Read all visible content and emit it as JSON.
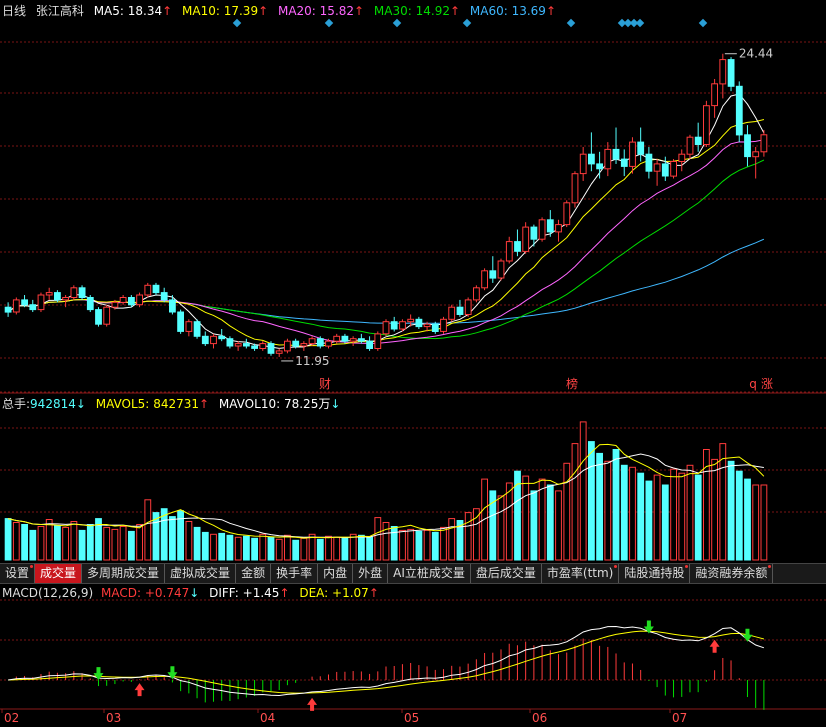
{
  "main_legend": {
    "period": "日线",
    "stock_name": "张江高科",
    "ma5_label": "MA5:",
    "ma5_value": "18.34",
    "ma10_label": "MA10:",
    "ma10_value": "17.39",
    "ma20_label": "MA20:",
    "ma20_value": "15.82",
    "ma30_label": "MA30:",
    "ma30_value": "14.92",
    "ma60_label": "MA60:",
    "ma60_value": "13.69",
    "up_arrow": "↑"
  },
  "volume_legend": {
    "total_label": "总手:",
    "total_value": "942814",
    "total_arrow": "↓",
    "mavol5_label": "MAVOL5:",
    "mavol5_value": "842731",
    "mavol5_arrow": "↑",
    "mavol10_label": "MAVOL10:",
    "mavol10_value": "78.25万",
    "mavol10_arrow": "↓"
  },
  "macd_legend": {
    "name": "MACD(12,26,9)",
    "macd_label": "MACD:",
    "macd_value": "+0.747",
    "macd_arrow": "↓",
    "diff_label": "DIFF:",
    "diff_value": "+1.45",
    "diff_arrow": "↑",
    "dea_label": "DEA:",
    "dea_value": "+1.07",
    "dea_arrow": "↑"
  },
  "tabs": [
    {
      "label": "设置",
      "dot": true
    },
    {
      "label": "成交量",
      "active": true
    },
    {
      "label": "多周期成交量"
    },
    {
      "label": "虚拟成交量"
    },
    {
      "label": "金额"
    },
    {
      "label": "换手率"
    },
    {
      "label": "内盘"
    },
    {
      "label": "外盘"
    },
    {
      "label": "AI立桩成交量"
    },
    {
      "label": "盘后成交量"
    },
    {
      "label": "市盈率(ttm)",
      "dot": true
    },
    {
      "label": "陆股通持股",
      "dot": true
    },
    {
      "label": "融资融券余额",
      "dot": true
    }
  ],
  "markers": {
    "low_price": "11.95",
    "high_price": "24.44",
    "event_cai": "财",
    "event_bang": "榜",
    "event_q": "q",
    "event_zhang": "涨"
  },
  "x_axis_labels": [
    "02",
    "03",
    "04",
    "05",
    "06",
    "07"
  ],
  "colors": {
    "up": "#ff3b3b",
    "down": "#54ffff",
    "ma5": "#ffffff",
    "ma10": "#ffff00",
    "ma20": "#ff66ff",
    "ma30": "#00dd00",
    "ma60": "#3fb8ff",
    "grid": "#7a1414",
    "diamond": "#2a9fd6"
  },
  "chart_data": {
    "type": "candlestick",
    "title": "张江高科 日线",
    "price_range": [
      11.0,
      25.5
    ],
    "ohlc": [
      [
        14.0,
        14.2,
        13.6,
        13.8
      ],
      [
        13.8,
        14.4,
        13.7,
        14.3
      ],
      [
        14.3,
        14.5,
        14.0,
        14.1
      ],
      [
        14.1,
        14.3,
        13.8,
        13.9
      ],
      [
        13.9,
        14.6,
        13.8,
        14.5
      ],
      [
        14.5,
        14.8,
        14.3,
        14.6
      ],
      [
        14.6,
        14.7,
        14.2,
        14.3
      ],
      [
        14.3,
        14.5,
        14.0,
        14.4
      ],
      [
        14.4,
        14.9,
        14.3,
        14.8
      ],
      [
        14.8,
        14.9,
        14.3,
        14.4
      ],
      [
        14.4,
        14.5,
        13.8,
        13.9
      ],
      [
        13.9,
        14.0,
        13.2,
        13.3
      ],
      [
        13.3,
        14.1,
        13.2,
        14.0
      ],
      [
        14.0,
        14.3,
        13.9,
        14.2
      ],
      [
        14.2,
        14.5,
        14.1,
        14.4
      ],
      [
        14.4,
        14.5,
        14.0,
        14.1
      ],
      [
        14.1,
        14.6,
        14.0,
        14.5
      ],
      [
        14.5,
        15.0,
        14.4,
        14.9
      ],
      [
        14.9,
        15.0,
        14.5,
        14.6
      ],
      [
        14.6,
        14.8,
        14.2,
        14.3
      ],
      [
        14.3,
        14.5,
        13.7,
        13.8
      ],
      [
        13.8,
        13.9,
        12.9,
        13.0
      ],
      [
        13.0,
        13.5,
        12.8,
        13.4
      ],
      [
        13.4,
        13.5,
        12.7,
        12.8
      ],
      [
        12.8,
        13.0,
        12.4,
        12.5
      ],
      [
        12.5,
        12.9,
        12.3,
        12.8
      ],
      [
        12.8,
        13.1,
        12.6,
        12.7
      ],
      [
        12.7,
        12.8,
        12.3,
        12.4
      ],
      [
        12.4,
        12.6,
        12.2,
        12.5
      ],
      [
        12.5,
        12.7,
        12.3,
        12.4
      ],
      [
        12.4,
        12.5,
        12.2,
        12.3
      ],
      [
        12.3,
        12.6,
        12.2,
        12.5
      ],
      [
        12.5,
        12.6,
        12.0,
        12.1
      ],
      [
        12.1,
        12.3,
        11.95,
        12.2
      ],
      [
        12.2,
        12.7,
        12.1,
        12.6
      ],
      [
        12.6,
        12.7,
        12.3,
        12.4
      ],
      [
        12.4,
        12.6,
        12.2,
        12.5
      ],
      [
        12.5,
        12.8,
        12.4,
        12.7
      ],
      [
        12.7,
        12.8,
        12.3,
        12.4
      ],
      [
        12.4,
        12.7,
        12.3,
        12.6
      ],
      [
        12.6,
        12.9,
        12.5,
        12.8
      ],
      [
        12.8,
        12.9,
        12.5,
        12.6
      ],
      [
        12.6,
        12.8,
        12.4,
        12.7
      ],
      [
        12.7,
        12.9,
        12.5,
        12.6
      ],
      [
        12.6,
        12.8,
        12.2,
        12.3
      ],
      [
        12.3,
        13.0,
        12.2,
        12.9
      ],
      [
        12.9,
        13.5,
        12.8,
        13.4
      ],
      [
        13.4,
        13.6,
        13.0,
        13.1
      ],
      [
        13.1,
        13.5,
        13.0,
        13.4
      ],
      [
        13.4,
        13.7,
        13.2,
        13.5
      ],
      [
        13.5,
        13.6,
        13.1,
        13.2
      ],
      [
        13.2,
        13.4,
        13.0,
        13.3
      ],
      [
        13.3,
        13.4,
        12.9,
        13.0
      ],
      [
        13.0,
        13.6,
        12.9,
        13.5
      ],
      [
        13.5,
        14.1,
        13.4,
        14.0
      ],
      [
        14.0,
        14.3,
        13.6,
        13.7
      ],
      [
        13.7,
        14.4,
        13.6,
        14.3
      ],
      [
        14.3,
        14.9,
        14.2,
        14.8
      ],
      [
        14.8,
        15.6,
        14.7,
        15.5
      ],
      [
        15.5,
        16.1,
        15.0,
        15.2
      ],
      [
        15.2,
        16.0,
        15.1,
        15.9
      ],
      [
        15.9,
        16.9,
        15.8,
        16.7
      ],
      [
        16.7,
        17.2,
        16.1,
        16.3
      ],
      [
        16.3,
        17.5,
        16.2,
        17.3
      ],
      [
        17.3,
        17.4,
        16.5,
        16.8
      ],
      [
        16.8,
        17.7,
        16.7,
        17.6
      ],
      [
        17.6,
        18.0,
        16.9,
        17.1
      ],
      [
        17.1,
        17.6,
        16.7,
        17.4
      ],
      [
        17.4,
        18.4,
        17.3,
        18.3
      ],
      [
        18.3,
        19.6,
        18.1,
        19.5
      ],
      [
        19.5,
        20.6,
        19.2,
        20.3
      ],
      [
        20.3,
        21.2,
        19.6,
        19.9
      ],
      [
        19.9,
        20.4,
        19.3,
        19.7
      ],
      [
        19.7,
        20.8,
        19.4,
        20.5
      ],
      [
        20.5,
        21.4,
        19.9,
        20.1
      ],
      [
        20.1,
        20.5,
        19.4,
        19.8
      ],
      [
        19.8,
        21.0,
        19.5,
        20.8
      ],
      [
        20.8,
        21.4,
        20.0,
        20.3
      ],
      [
        20.3,
        20.6,
        19.3,
        19.6
      ],
      [
        19.6,
        20.1,
        19.0,
        19.9
      ],
      [
        19.9,
        20.2,
        19.2,
        19.4
      ],
      [
        19.4,
        20.1,
        19.3,
        20.0
      ],
      [
        20.0,
        20.5,
        19.6,
        20.3
      ],
      [
        20.3,
        21.1,
        20.1,
        21.0
      ],
      [
        21.0,
        21.6,
        20.4,
        20.7
      ],
      [
        20.7,
        22.5,
        20.6,
        22.3
      ],
      [
        22.3,
        23.4,
        21.8,
        23.2
      ],
      [
        23.2,
        24.44,
        22.6,
        24.2
      ],
      [
        24.2,
        24.3,
        22.9,
        23.1
      ],
      [
        23.1,
        23.3,
        20.8,
        21.1
      ],
      [
        21.1,
        21.5,
        19.8,
        20.2
      ],
      [
        20.2,
        20.6,
        19.3,
        20.4
      ],
      [
        20.4,
        21.3,
        20.2,
        21.1
      ]
    ],
    "volume": [
      420000,
      380000,
      360000,
      300000,
      340000,
      410000,
      350000,
      330000,
      390000,
      300000,
      360000,
      420000,
      330000,
      310000,
      340000,
      290000,
      360000,
      610000,
      480000,
      520000,
      440000,
      500000,
      390000,
      330000,
      280000,
      260000,
      270000,
      250000,
      230000,
      240000,
      220000,
      260000,
      230000,
      210000,
      250000,
      200000,
      220000,
      260000,
      210000,
      240000,
      230000,
      220000,
      260000,
      250000,
      230000,
      430000,
      380000,
      340000,
      300000,
      310000,
      290000,
      300000,
      280000,
      330000,
      420000,
      400000,
      480000,
      520000,
      820000,
      700000,
      650000,
      780000,
      900000,
      850000,
      700000,
      820000,
      760000,
      700000,
      980000,
      1180000,
      1400000,
      1200000,
      1080000,
      1000000,
      1120000,
      960000,
      940000,
      880000,
      800000,
      860000,
      760000,
      920000,
      880000,
      960000,
      860000,
      1120000,
      1020000,
      1180000,
      1000000,
      900000,
      820000,
      760000,
      760000
    ],
    "volume_up_flags": [
      false,
      true,
      false,
      false,
      true,
      true,
      false,
      true,
      true,
      false,
      false,
      false,
      true,
      true,
      true,
      false,
      true,
      true,
      false,
      false,
      false,
      false,
      true,
      false,
      false,
      true,
      false,
      false,
      true,
      false,
      false,
      true,
      false,
      true,
      true,
      false,
      true,
      true,
      false,
      true,
      true,
      false,
      true,
      false,
      false,
      true,
      true,
      false,
      true,
      true,
      false,
      true,
      false,
      true,
      true,
      false,
      true,
      true,
      true,
      false,
      true,
      true,
      false,
      true,
      false,
      true,
      false,
      true,
      true,
      true,
      true,
      false,
      false,
      true,
      false,
      false,
      true,
      false,
      false,
      true,
      false,
      true,
      true,
      true,
      false,
      true,
      true,
      true,
      false,
      false,
      false,
      true,
      true
    ],
    "volume_range": [
      0,
      1500000
    ],
    "macd_hist_range": [
      -1.2,
      1.2
    ]
  }
}
